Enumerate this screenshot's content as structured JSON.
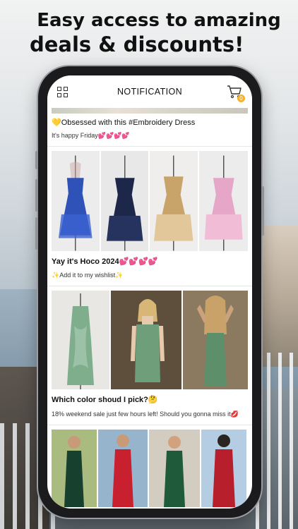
{
  "promo": {
    "line1": "Easy access to amazing",
    "line2": "deals & discounts!"
  },
  "app": {
    "title": "NOTIFICATION",
    "cart_count": "0",
    "icons": {
      "menu": "grid-icon",
      "cart": "cart-icon"
    }
  },
  "posts": [
    {
      "caption": "💛Obsessed with this #Embroidery Dress",
      "subtext": "It's happy Friday💕💕💕💕"
    },
    {
      "caption": "Yay it's Hoco 2024💕💕💕💕",
      "subtext": "✨Add it to my wishlist✨",
      "dress_colors": [
        "#2f52b8",
        "#1d2749",
        "#c9a46a",
        "#e6a6c7"
      ]
    },
    {
      "caption": "Which color shoud I pick?🤔",
      "subtext": "18% weekend sale just few hours left! Should you gonna miss it💋",
      "dress_colors": [
        "#7fae8c",
        "#6e9f7a",
        "#5d8f6b"
      ]
    },
    {
      "dress_colors": [
        "#17402e",
        "#c8202e",
        "#1f5a3a",
        "#b81f2c"
      ]
    }
  ],
  "colors": {
    "accent": "#f4b32b",
    "text": "#111111"
  }
}
